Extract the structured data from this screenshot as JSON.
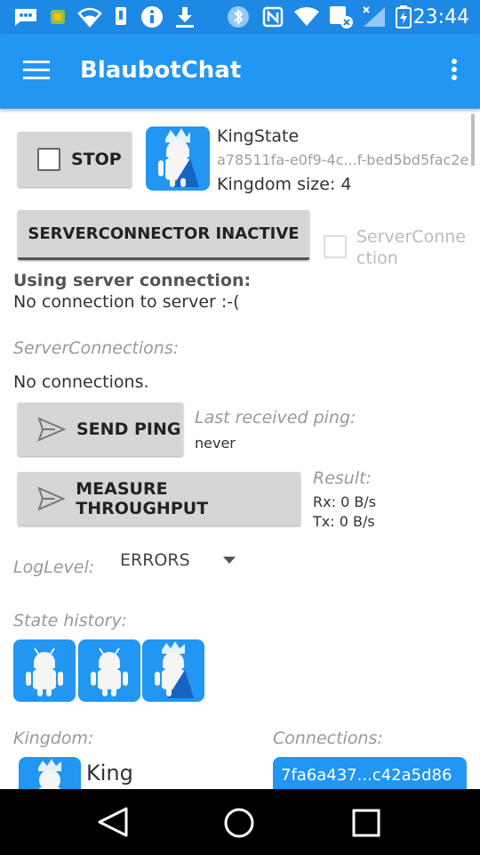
{
  "statusbar": {
    "time": "23:44"
  },
  "appbar": {
    "title": "BlaubotChat"
  },
  "top": {
    "stop_label": "STOP",
    "king_name": "KingState",
    "king_id": "a78511fa-e0f9-4c...f-bed5bd5fac2e",
    "kingdom_size": "Kingdom size: 4"
  },
  "server": {
    "connector_button": "SERVERCONNECTOR INACTIVE",
    "checkbox_label_line1": "ServerConne",
    "checkbox_label_line2": "ction",
    "using_label": "Using server connection:",
    "using_value": "No connection to server :-(",
    "connections_label": "ServerConnections:",
    "connections_value": "No connections."
  },
  "ping": {
    "button_label": "SEND PING",
    "last_label": "Last received ping:",
    "last_value": "never"
  },
  "throughput": {
    "button_label": "MEASURE THROUGHPUT",
    "result_label": "Result:",
    "rx": "Rx: 0 B/s",
    "tx": "Tx: 0 B/s"
  },
  "log": {
    "label": "LogLevel:",
    "selected": "ERRORS"
  },
  "history": {
    "label": "State history:"
  },
  "kingdom": {
    "label": "Kingdom:",
    "member_name": "King"
  },
  "connections": {
    "label": "Connections:",
    "item": "7fa6a437...c42a5d86"
  },
  "colors": {
    "appbar": "#2196F3",
    "statusbar": "#1E88E5",
    "accent": "#2196F3"
  }
}
